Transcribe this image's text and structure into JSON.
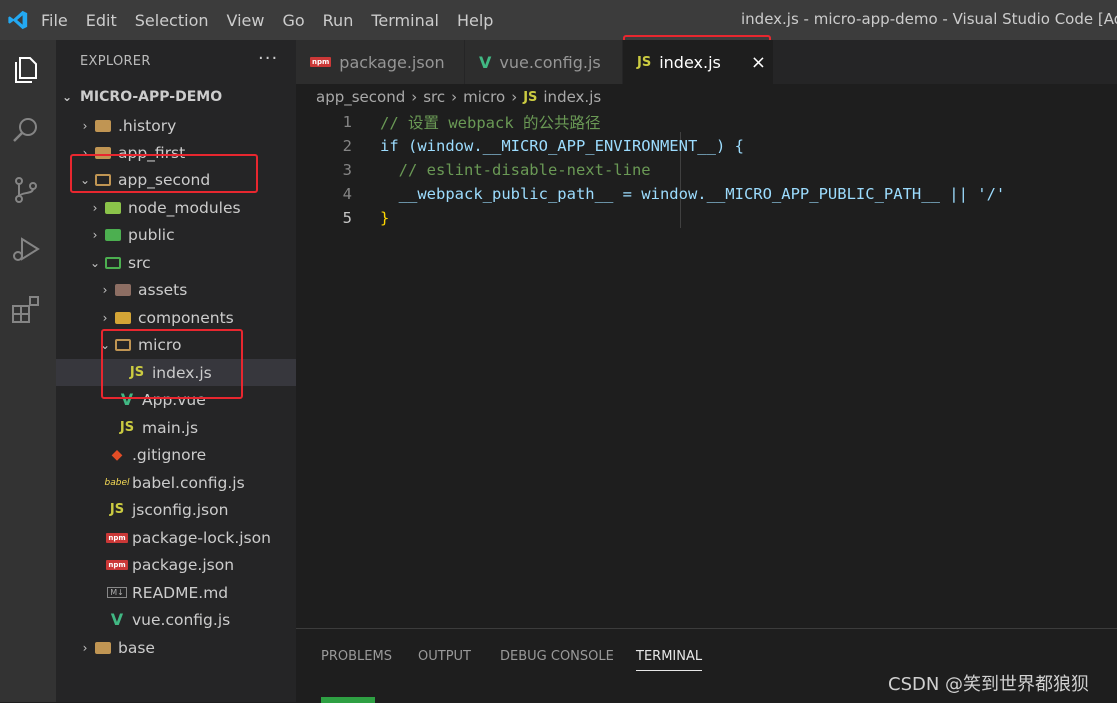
{
  "titlebar": {
    "menu": [
      "File",
      "Edit",
      "Selection",
      "View",
      "Go",
      "Run",
      "Terminal",
      "Help"
    ],
    "window_title": "index.js - micro-app-demo - Visual Studio Code [Adminis"
  },
  "activity": [
    "files-icon",
    "search-icon",
    "source-control-icon",
    "run-debug-icon",
    "extensions-icon"
  ],
  "sidebar": {
    "header": "EXPLORER",
    "more": "···",
    "root": "MICRO-APP-DEMO",
    "items": [
      {
        "label": ".history"
      },
      {
        "label": "app_first"
      },
      {
        "label": "app_second"
      },
      {
        "label": "node_modules"
      },
      {
        "label": "public"
      },
      {
        "label": "src"
      },
      {
        "label": "assets"
      },
      {
        "label": "components"
      },
      {
        "label": "micro"
      },
      {
        "label": "index.js"
      },
      {
        "label": "App.vue"
      },
      {
        "label": "main.js"
      },
      {
        "label": ".gitignore"
      },
      {
        "label": "babel.config.js"
      },
      {
        "label": "jsconfig.json"
      },
      {
        "label": "package-lock.json"
      },
      {
        "label": "package.json"
      },
      {
        "label": "README.md"
      },
      {
        "label": "vue.config.js"
      },
      {
        "label": "base"
      }
    ]
  },
  "tabs": [
    {
      "label": "package.json"
    },
    {
      "label": "vue.config.js"
    },
    {
      "label": "index.js",
      "close": "×"
    }
  ],
  "breadcrumb": [
    "app_second",
    "src",
    "micro",
    "index.js"
  ],
  "editor": {
    "line_numbers": [
      "1",
      "2",
      "3",
      "4",
      "5"
    ],
    "lines": [
      "// 设置 webpack 的公共路径",
      "if (window.__MICRO_APP_ENVIRONMENT__) {",
      "  // eslint-disable-next-line",
      "  __webpack_public_path__ = window.__MICRO_APP_PUBLIC_PATH__ || '/'",
      "}"
    ]
  },
  "panel": {
    "tabs": [
      "PROBLEMS",
      "OUTPUT",
      "DEBUG CONSOLE",
      "TERMINAL"
    ],
    "active": "TERMINAL"
  },
  "watermark": "CSDN @笑到世界都狼狈",
  "colors": {
    "accent_red": "#e8272f",
    "js_yellow": "#cbcb41",
    "vue_green": "#41b883"
  }
}
